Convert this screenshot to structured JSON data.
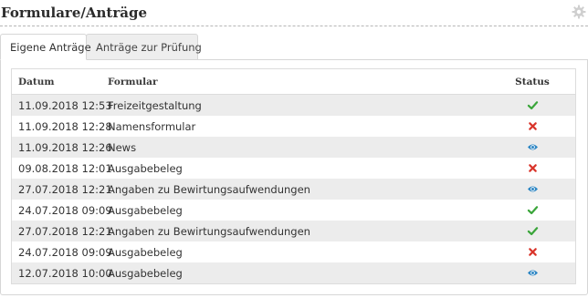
{
  "page": {
    "title": "Formulare/Anträge"
  },
  "tabs": [
    {
      "label": "Eigene Anträge",
      "active": true
    },
    {
      "label": "Anträge zur Prüfung",
      "active": false
    }
  ],
  "table": {
    "headers": {
      "date": "Datum",
      "form": "Formular",
      "status": "Status"
    },
    "rows": [
      {
        "date": "11.09.2018 12:53",
        "form": "Freizeitgestaltung",
        "status": "check-icon"
      },
      {
        "date": "11.09.2018 12:28",
        "form": "Namensformular",
        "status": "cross-icon"
      },
      {
        "date": "11.09.2018 12:26",
        "form": "News",
        "status": "eye-icon"
      },
      {
        "date": "09.08.2018 12:01",
        "form": "Ausgabebeleg",
        "status": "cross-icon"
      },
      {
        "date": "27.07.2018 12:21",
        "form": "Angaben zu Bewirtungsaufwendungen",
        "status": "eye-icon"
      },
      {
        "date": "24.07.2018 09:09",
        "form": "Ausgabebeleg",
        "status": "check-icon"
      },
      {
        "date": "27.07.2018 12:21",
        "form": "Angaben zu Bewirtungsaufwendungen",
        "status": "check-icon"
      },
      {
        "date": "24.07.2018 09:09",
        "form": "Ausgabebeleg",
        "status": "cross-icon"
      },
      {
        "date": "12.07.2018 10:00",
        "form": "Ausgabebeleg",
        "status": "eye-icon"
      }
    ]
  },
  "colors": {
    "check": "#3aa53a",
    "cross": "#d9352b",
    "eye": "#2d86c4",
    "gear": "#cfcfcf"
  }
}
